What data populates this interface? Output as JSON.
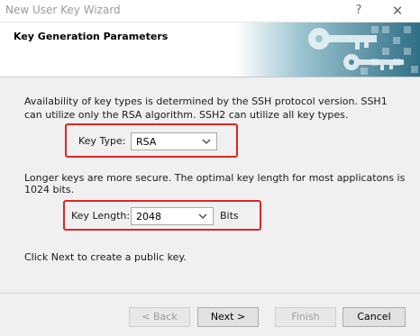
{
  "window": {
    "title": "New User Key Wizard",
    "help_glyph": "?",
    "close_glyph": "✕"
  },
  "header": {
    "title": "Key Generation Parameters",
    "art": "keys-banner"
  },
  "body": {
    "intro": "Availability of key types is determined by the SSH protocol version. SSH1 can utilize only the RSA algorithm. SSH2 can utilize all key types.",
    "key_type": {
      "label": "Key Type:",
      "value": "RSA"
    },
    "length_note": "Longer keys are more secure. The optimal key length for most applicatons is 1024 bits.",
    "key_length": {
      "label": "Key Length:",
      "value": "2048",
      "unit": "Bits"
    },
    "next_note": "Click Next to create a public key."
  },
  "buttons": {
    "back": "< Back",
    "next": "Next >",
    "finish": "Finish",
    "cancel": "Cancel"
  },
  "colors": {
    "highlight": "#e02424",
    "banner": "#2f6f86"
  }
}
